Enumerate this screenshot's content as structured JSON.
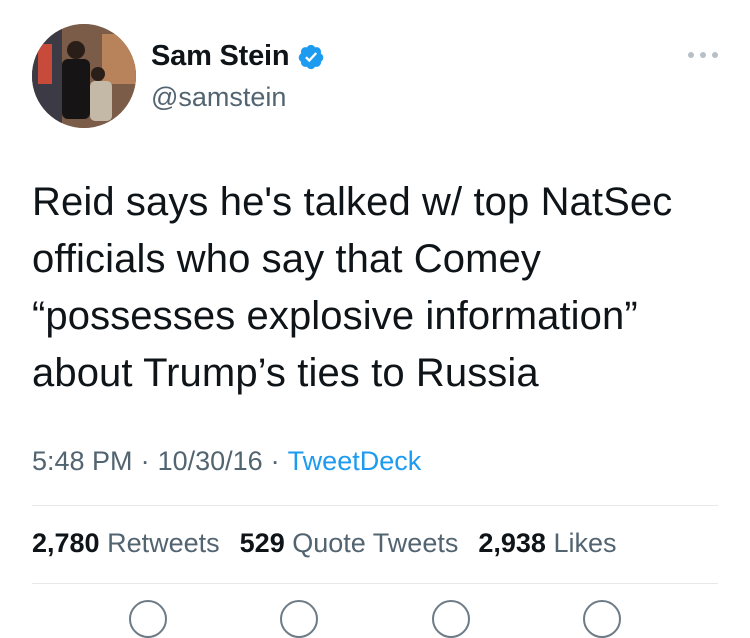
{
  "author": {
    "display_name": "Sam Stein",
    "handle": "@samstein"
  },
  "tweet": {
    "text": "Reid says he's talked w/ top NatSec\nofficials who say that Comey\n“possesses explosive information”\nabout Trump’s ties to Russia"
  },
  "meta": {
    "time": "5:48 PM",
    "separator1": "·",
    "date": "10/30/16",
    "separator2": "·",
    "source": "TweetDeck"
  },
  "stats": {
    "retweets_count": "2,780",
    "retweets_label": "Retweets",
    "quotes_count": "529",
    "quotes_label": "Quote Tweets",
    "likes_count": "2,938",
    "likes_label": "Likes"
  },
  "colors": {
    "verified_badge": "#1d9bf0",
    "link": "#1d9bf0",
    "secondary_text": "#536471"
  },
  "icons": {
    "verified": "verified-badge-icon",
    "more": "more-options-icon",
    "actions": [
      "reply-icon",
      "retweet-icon",
      "like-icon",
      "share-icon"
    ]
  }
}
